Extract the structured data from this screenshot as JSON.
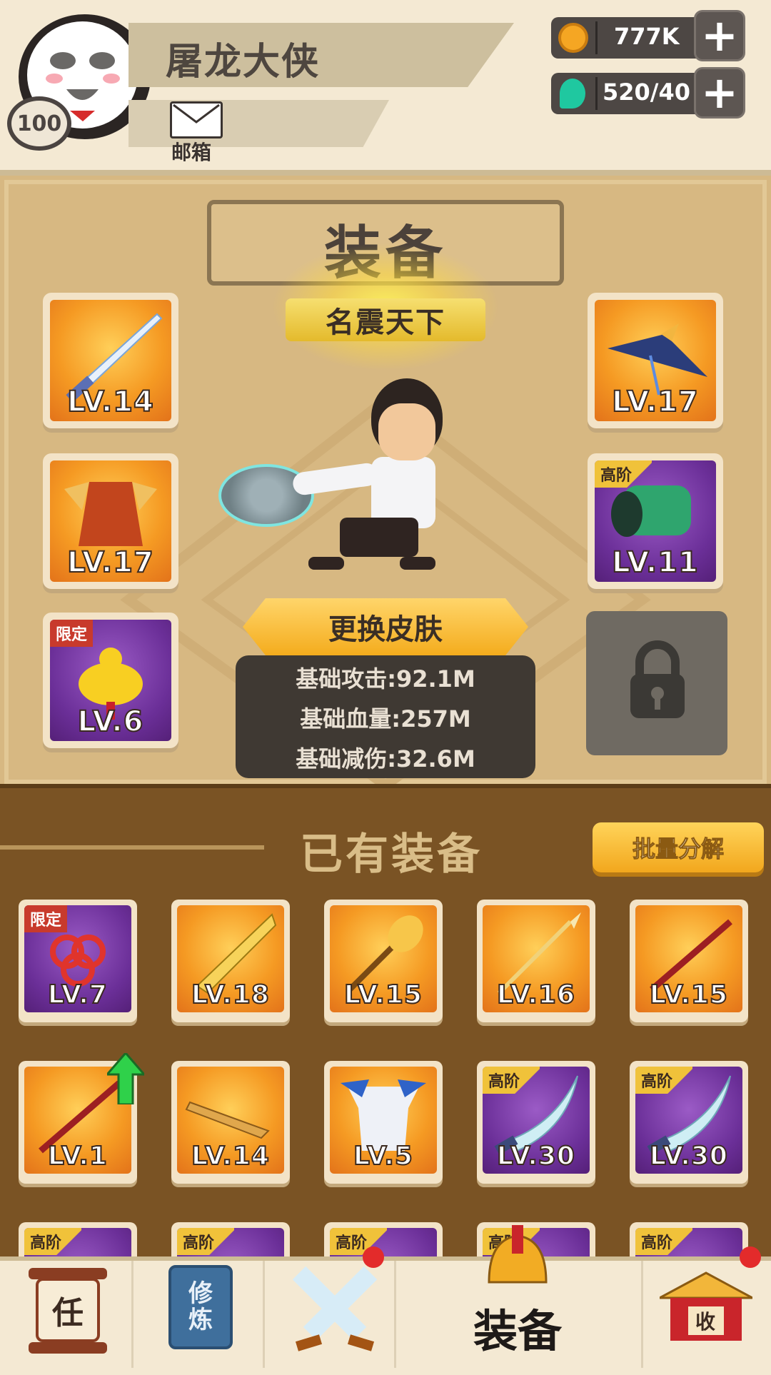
{
  "header": {
    "player_name": "屠龙大侠",
    "player_level": "100",
    "mail_label": "邮箱",
    "coins": "777K",
    "gems": "520/40"
  },
  "equip_panel": {
    "title": "装备",
    "rank_title": "名震天下",
    "change_skin_label": "更换皮肤",
    "stats": [
      "基础攻击:92.1M",
      "基础血量:257M",
      "基础减伤:32.6M"
    ],
    "left_slots": [
      {
        "name": "sword",
        "level": "LV.14",
        "tag": ""
      },
      {
        "name": "armor",
        "level": "LV.17",
        "tag": ""
      },
      {
        "name": "gourd-pendant",
        "level": "LV.6",
        "tag": "限定"
      }
    ],
    "right_slots": [
      {
        "name": "hat",
        "level": "LV.17",
        "tag": ""
      },
      {
        "name": "bracer",
        "level": "LV.11",
        "tag": "高阶"
      }
    ]
  },
  "owned": {
    "title": "已有装备",
    "batch_button": "批量分解",
    "items_row1": [
      {
        "name": "knot-charm",
        "level": "LV.7",
        "tag": "限定",
        "bg": "purple"
      },
      {
        "name": "broadsword",
        "level": "LV.18",
        "tag": "",
        "bg": "orange"
      },
      {
        "name": "mace",
        "level": "LV.15",
        "tag": "",
        "bg": "orange"
      },
      {
        "name": "spear",
        "level": "LV.16",
        "tag": "",
        "bg": "orange"
      },
      {
        "name": "staff",
        "level": "LV.15",
        "tag": "",
        "bg": "orange"
      }
    ],
    "items_row2": [
      {
        "name": "staff",
        "level": "LV.1",
        "tag": "",
        "bg": "orange"
      },
      {
        "name": "key-blade",
        "level": "LV.14",
        "tag": "",
        "bg": "orange"
      },
      {
        "name": "robe",
        "level": "LV.5",
        "tag": "",
        "bg": "orange"
      },
      {
        "name": "saber",
        "level": "LV.30",
        "tag": "高阶",
        "bg": "purple"
      },
      {
        "name": "saber",
        "level": "LV.30",
        "tag": "高阶",
        "bg": "purple"
      }
    ],
    "items_row3_tags": [
      "高阶",
      "高阶",
      "高阶",
      "高阶",
      "高阶"
    ]
  },
  "nav": {
    "tasks_glyph": "任",
    "cultivate_glyph": "修\n炼",
    "equip_label": "装备",
    "collect_glyph": "收"
  },
  "colors": {
    "panel": "#d7b882",
    "owned_bg": "#7a5324",
    "orange_slot": "#f59a23",
    "purple_slot": "#6b2f98"
  }
}
